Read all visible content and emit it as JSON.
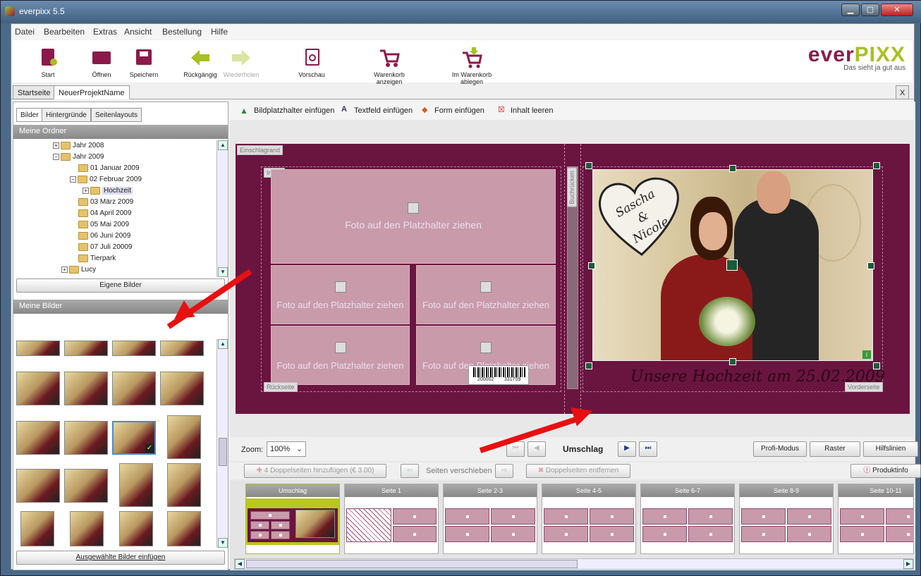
{
  "window": {
    "title": "everpixx 5.5"
  },
  "menu": [
    "Datei",
    "Bearbeiten",
    "Extras",
    "Ansicht",
    "Bestellung",
    "Hilfe"
  ],
  "toolbar": {
    "start": "Start",
    "open": "Öffnen",
    "save": "Speichern",
    "undo": "Rückgängig",
    "redo": "Wiederholen",
    "preview": "Vorschau",
    "cart_show": "Warenkorb anzeigen",
    "cart_add": "Im Warenkorb ablegen"
  },
  "logo": {
    "part1": "ever",
    "part2": "PIXX",
    "tagline": "Das sieht ja gut aus"
  },
  "tabs": {
    "start": "Startseite",
    "project": "NeuerProjektName",
    "close": "X"
  },
  "left": {
    "subtabs": [
      "Bilder",
      "Hintergründe",
      "Seitenlayouts"
    ],
    "folders_header": "Meine Ordner",
    "tree": [
      "Jahr 2008",
      "Jahr 2009",
      "01 Januar 2009",
      "02 Februar 2009",
      "Hochzeit",
      "03 März 2009",
      "04 April 2009",
      "05 Mai 2009",
      "06 Juni 2009",
      "07 Juli 20009",
      "Tierpark",
      "Lucy"
    ],
    "own_images_btn": "Eigene Bilder",
    "images_header": "Meine Bilder",
    "insert_btn": "Ausgewählte Bilder einfügen"
  },
  "content_toolbar": {
    "add_image_ph": "Bildplatzhalter einfügen",
    "add_text": "Textfeld einfügen",
    "add_shape": "Form einfügen",
    "clear": "Inhalt leeren"
  },
  "canvas": {
    "einschlag": "Einschlagrand",
    "inhalt": "Inhalt",
    "buchruecken": "Buchrücken",
    "rueckseite": "Rückseite",
    "vorderseite": "Vorderseite",
    "placeholder": "Foto auf den Platzhalter ziehen",
    "heart_text": [
      "Sascha",
      "&",
      "Nicole"
    ],
    "caption": "Unsere Hochzeit am 25.02.2009",
    "barcode_left": "200002",
    "barcode_right": "331709"
  },
  "zoom": {
    "label": "Zoom:",
    "value": "100%",
    "page": "Umschlag",
    "profi": "Profi-Modus",
    "raster": "Raster",
    "hilfslinien": "Hilfslinien"
  },
  "pagebar": {
    "add": "4 Doppelseiten hinzufügen (€ 3.00)",
    "move": "Seiten verschieben",
    "remove": "Doppelseiten entfernen",
    "info": "Produktinfo"
  },
  "pages": [
    "Umschlag",
    "Seite 1",
    "Seite 2-3",
    "Seite 4-5",
    "Seite 6-7",
    "Seite 8-9",
    "Seite 10-11"
  ],
  "colors": {
    "accent": "#6a1440",
    "brand_green": "#a8c020",
    "arrow": "#e81010"
  }
}
